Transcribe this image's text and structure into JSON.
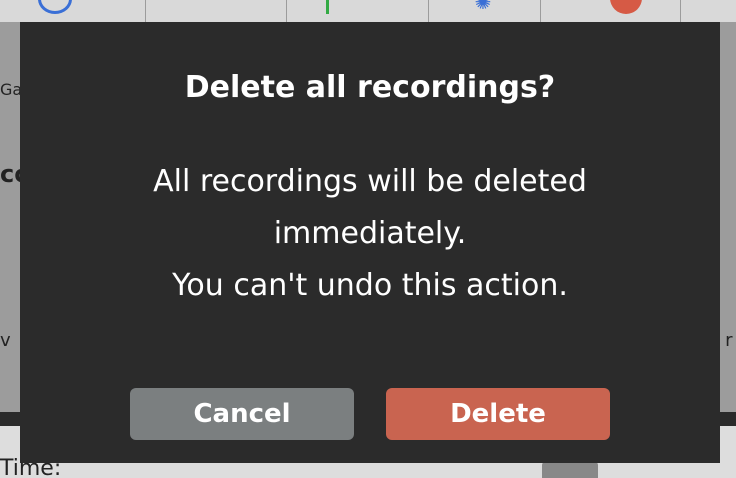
{
  "background": {
    "gain_label": "Gai",
    "left_label": "co",
    "time_label": "Time:",
    "right_fragment": "d r",
    "left_fragment": "v"
  },
  "dialog": {
    "title": "Delete all recordings?",
    "message_lines": [
      "All recordings will be deleted",
      "immediately.",
      "You can't undo this action."
    ],
    "cancel_label": "Cancel",
    "delete_label": "Delete"
  },
  "colors": {
    "dialog_bg": "#2b2b2b",
    "cancel_bg": "#7b7f80",
    "delete_bg": "#c96450",
    "text": "#ffffff"
  }
}
